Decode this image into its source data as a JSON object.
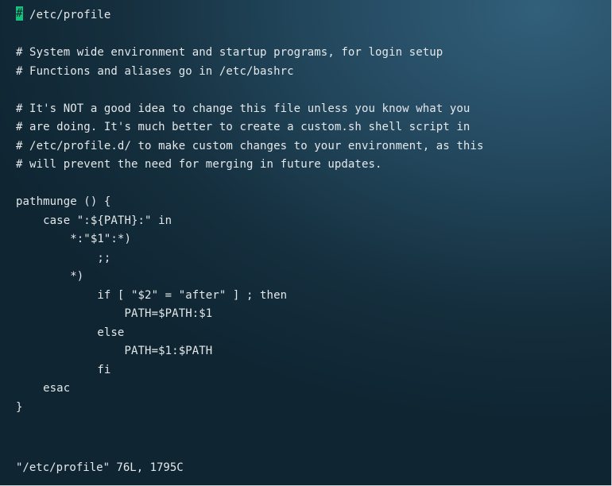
{
  "editor": {
    "cursor_char": "#",
    "lines": [
      " /etc/profile",
      "",
      "# System wide environment and startup programs, for login setup",
      "# Functions and aliases go in /etc/bashrc",
      "",
      "# It's NOT a good idea to change this file unless you know what you",
      "# are doing. It's much better to create a custom.sh shell script in",
      "# /etc/profile.d/ to make custom changes to your environment, as this",
      "# will prevent the need for merging in future updates.",
      "",
      "pathmunge () {",
      "    case \":${PATH}:\" in",
      "        *:\"$1\":*)",
      "            ;;",
      "        *)",
      "            if [ \"$2\" = \"after\" ] ; then",
      "                PATH=$PATH:$1",
      "            else",
      "                PATH=$1:$PATH",
      "            fi",
      "    esac",
      "}"
    ]
  },
  "status_line": "\"/etc/profile\" 76L, 1795C",
  "colors": {
    "cursor": "#16c07a",
    "text": "#e4e8ea",
    "background": "#1d3e52"
  }
}
